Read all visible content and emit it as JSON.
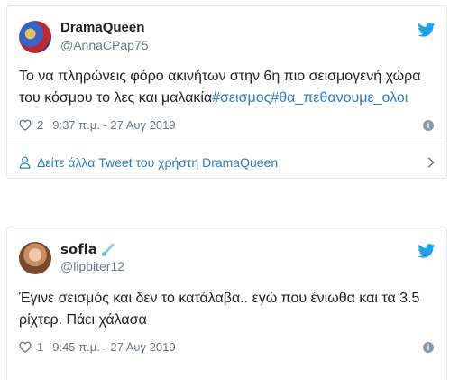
{
  "tweets": [
    {
      "display_name": "DramaQueen",
      "handle": "@AnnaCPap75",
      "text_plain": "Το να πληρώνεις φόρο ακινήτων στην 6η πιο σεισμογενή χώρα του κόσμου το λες και μαλακία",
      "hashtags": "#σεισμος#θα_πεθανουμε_ολοι",
      "likes": "2",
      "timestamp": "9:37 π.μ. - 27 Αυγ 2019",
      "footer_link": "Δείτε άλλα Tweet του χρήστη DramaQueen"
    },
    {
      "display_name": "𝘀𝗼𝗳𝗶𝗮",
      "handle": "@lipbiter12",
      "text_plain": "Έγινε σεισμός και δεν το κατάλαβα.. εγώ που ένιωθα και τα 3.5 ρίχτερ. Πάει χάλασα",
      "likes": "1",
      "timestamp": "9:45 π.μ. - 27 Αυγ 2019"
    }
  ],
  "icons": {
    "brand": "twitter-bird-icon",
    "like": "heart-icon",
    "info": "info-icon",
    "footer_user": "user-icon",
    "footer_chevron": "chevron-right-icon",
    "name_emoji": "comet-emoji-icon"
  },
  "colors": {
    "brand_blue": "#1da1f2",
    "link_blue": "#2b7bb9",
    "muted": "#697882",
    "border": "#e1e8ed"
  }
}
